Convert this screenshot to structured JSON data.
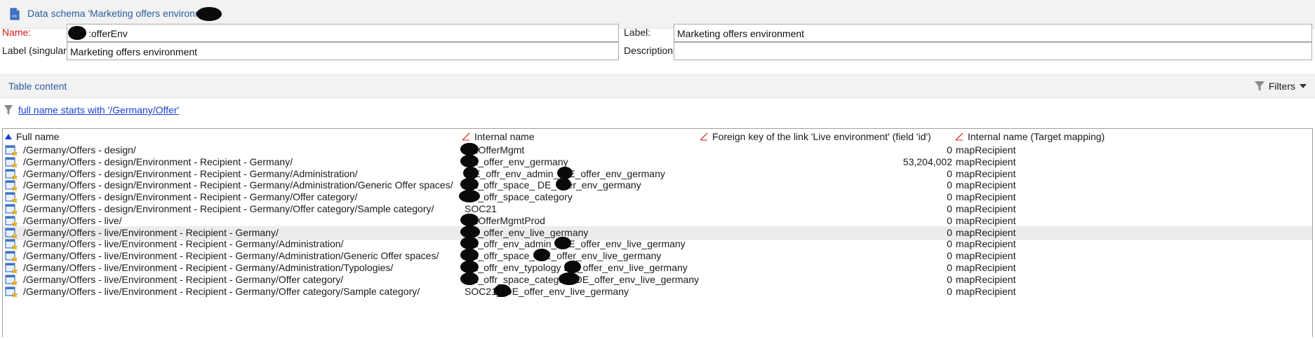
{
  "title": "Data schema 'Marketing offers environment",
  "form": {
    "name_label": "Name:",
    "name_value": ":offerEnv",
    "label_label": "Label:",
    "label_value": "Marketing offers environment",
    "label_singular_label": "Label (singular):",
    "label_singular_value": "Marketing offers environment",
    "description_label": "Description:",
    "description_value": ""
  },
  "section": {
    "title": "Table content",
    "filters_label": "Filters"
  },
  "filter": {
    "text": "full name starts with '/Germany/Offer'"
  },
  "table": {
    "columns": [
      "Full name",
      "Internal name",
      "Foreign key of the link 'Live environment' (field 'id')",
      "Internal name (Target mapping)"
    ],
    "rows": [
      {
        "full_name": "/Germany/Offers - design/",
        "internal_name": "DEOfferMgmt",
        "foreign_key": "0",
        "target_mapping": "mapRecipient"
      },
      {
        "full_name": "/Germany/Offers - design/Environment - Recipient - Germany/",
        "internal_name": "DE_offer_env_germany",
        "foreign_key": "53,204,002",
        "target_mapping": "mapRecipient"
      },
      {
        "full_name": "/Germany/Offers - design/Environment - Recipient - Germany/Administration/",
        "internal_name": "iDE_offr_env_admin_   DE_offer_env_germany",
        "foreign_key": "0",
        "target_mapping": "mapRecipient"
      },
      {
        "full_name": "/Germany/Offers - design/Environment - Recipient - Germany/Administration/Generic Offer spaces/",
        "internal_name": "DE_offr_space_    DE_offer_env_germany",
        "foreign_key": "0",
        "target_mapping": "mapRecipient"
      },
      {
        "full_name": "/Germany/Offers - design/Environment - Recipient - Germany/Offer category/",
        "internal_name": "DE_offr_space_category",
        "foreign_key": "0",
        "target_mapping": "mapRecipient"
      },
      {
        "full_name": "/Germany/Offers - design/Environment - Recipient - Germany/Offer category/Sample category/",
        "internal_name": "SOC21",
        "foreign_key": "0",
        "target_mapping": "mapRecipient"
      },
      {
        "full_name": "/Germany/Offers - live/",
        "internal_name": "DEOfferMgmtProd",
        "foreign_key": "0",
        "target_mapping": "mapRecipient"
      },
      {
        "full_name": "/Germany/Offers - live/Environment - Recipient - Germany/",
        "internal_name": "DE_offer_env_live_germany",
        "foreign_key": "0",
        "target_mapping": "mapRecipient"
      },
      {
        "full_name": "/Germany/Offers - live/Environment - Recipient - Germany/Administration/",
        "internal_name": "DE_offr_env_admin_   iDE_offer_env_live_germany",
        "foreign_key": "0",
        "target_mapping": "mapRecipient"
      },
      {
        "full_name": "/Germany/Offers - live/Environment - Recipient - Germany/Administration/Generic Offer spaces/",
        "internal_name": "DE_offr_space_    DE_offer_env_live_germany",
        "foreign_key": "0",
        "target_mapping": "mapRecipient"
      },
      {
        "full_name": "/Germany/Offers - live/Environment - Recipient - Germany/Administration/Typologies/",
        "internal_name": "DE_offr_env_typology    DE_offer_env_live_germany",
        "foreign_key": "0",
        "target_mapping": "mapRecipient"
      },
      {
        "full_name": "/Germany/Offers - live/Environment - Recipient - Germany/Offer category/",
        "internal_name": "DE_offr_space_category    DE_offer_env_live_germany",
        "foreign_key": "0",
        "target_mapping": "mapRecipient"
      },
      {
        "full_name": "/Germany/Offers - live/Environment - Recipient - Germany/Offer category/Sample category/",
        "internal_name": "SOC21_     DE_offer_env_live_germany",
        "foreign_key": "0",
        "target_mapping": "mapRecipient"
      }
    ]
  },
  "colors": {
    "link_blue": "#1a3ed8",
    "title_blue": "#2a5d9f",
    "required_red": "#d81818",
    "selected_row": "#ececec"
  },
  "icons": [
    "schema-doc-icon",
    "filter-funnel-icon",
    "sort-ascending-icon",
    "language-icon",
    "folder-star-icon",
    "dropdown-arrow-icon"
  ]
}
